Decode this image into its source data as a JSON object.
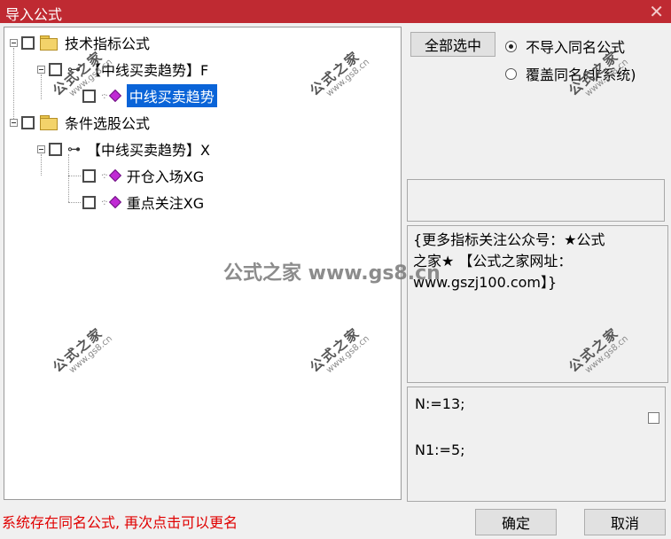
{
  "window": {
    "title": "导入公式",
    "close_glyph": "✕"
  },
  "tree": {
    "expander_icon": "minus-box-icon",
    "nodes": [
      {
        "label": "技术指标公式",
        "icon": "folder-icon"
      },
      {
        "label": "【中线买卖趋势】F",
        "icon": "key-icon"
      },
      {
        "label": "中线买卖趋势",
        "icon": "gem-icon",
        "selected": true
      },
      {
        "label": "条件选股公式",
        "icon": "folder-icon"
      },
      {
        "label": "【中线买卖趋势】X",
        "icon": "key-icon"
      },
      {
        "label": "开仓入场XG",
        "icon": "gem-icon"
      },
      {
        "label": "重点关注XG",
        "icon": "gem-icon"
      }
    ]
  },
  "buttons": {
    "select_all": "全部选中",
    "ok": "确定",
    "cancel": "取消"
  },
  "options": {
    "no_import": "不导入同名公式",
    "overwrite": "覆盖同名(非系统)",
    "selected": "no_import"
  },
  "description": {
    "line1": "{更多指标关注公众号：★公式",
    "line2": "之家★ 【公式之家网址：",
    "line3": "www.gszj100.com】}"
  },
  "params": {
    "line1": "N:=13;",
    "line2": "N1:=5;"
  },
  "status_text": "系统存在同名公式, 再次点击可以更名",
  "watermark": {
    "title": "公式之家",
    "url": "www.gs8.cn",
    "center": "公式之家 www.gs8.cn"
  },
  "colors": {
    "titlebar": "#bf2a32",
    "selection": "#0a64d8",
    "status": "#e00000"
  }
}
